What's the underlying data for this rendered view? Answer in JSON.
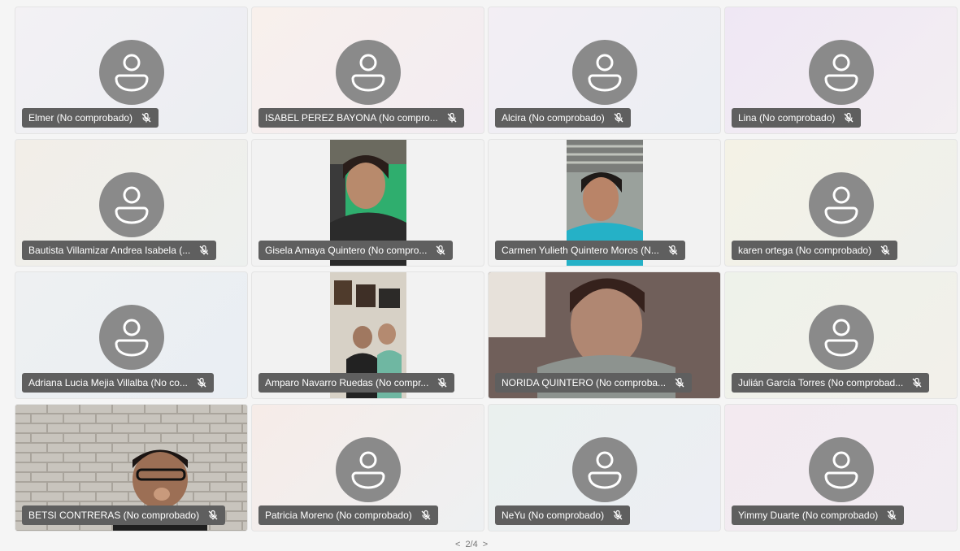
{
  "participants": [
    {
      "name": "Elmer (No comprobado)",
      "bg": "linear-gradient(135deg,#f3f1f4,#ebedf2)",
      "video": false
    },
    {
      "name": "ISABEL PEREZ BAYONA (No compro...",
      "bg": "linear-gradient(135deg,#f8f0ec,#f2ecf2)",
      "video": false
    },
    {
      "name": "Alcira (No comprobado)",
      "bg": "linear-gradient(135deg,#f3eef4,#ebeef3)",
      "video": false
    },
    {
      "name": "Lina (No comprobado)",
      "bg": "linear-gradient(135deg,#efe7f4,#f3eef2)",
      "video": false
    },
    {
      "name": "Bautista Villamizar Andrea Isabela (...",
      "bg": "linear-gradient(135deg,#f2eee8,#edf0ee)",
      "video": false
    },
    {
      "name": "Gisela Amaya Quintero (No compro...",
      "bg": "#f2f2f2",
      "video": "narrow-green"
    },
    {
      "name": "Carmen Yulieth Quintero Moros (N...",
      "bg": "#f2f2f2",
      "video": "narrow-blue"
    },
    {
      "name": "karen ortega (No comprobado)",
      "bg": "linear-gradient(135deg,#f4f2e6,#eef0ec)",
      "video": false
    },
    {
      "name": "Adriana Lucia Mejia Villalba (No co...",
      "bg": "linear-gradient(135deg,#eef0f2,#e9eef3)",
      "video": false
    },
    {
      "name": "Amparo Navarro Ruedas (No compr...",
      "bg": "#f2f2f2",
      "video": "narrow-room"
    },
    {
      "name": "NORIDA QUINTERO (No comproba...",
      "bg": "#6f625d",
      "video": "full"
    },
    {
      "name": "Julián García Torres (No comprobad...",
      "bg": "linear-gradient(135deg,#eef2ea,#f2f0ea)",
      "video": false
    },
    {
      "name": "BETSI CONTRERAS (No comprobado)",
      "bg": "#b9b4ae",
      "video": "brick"
    },
    {
      "name": "Patricia Moreno (No comprobado)",
      "bg": "linear-gradient(135deg,#f6ece8,#eef0f2)",
      "video": false
    },
    {
      "name": "NeYu (No comprobado)",
      "bg": "linear-gradient(135deg,#eaf0ee,#eceef4)",
      "video": false
    },
    {
      "name": "Yimmy Duarte (No comprobado)",
      "bg": "linear-gradient(135deg,#f3eaf0,#f1ecf2)",
      "video": false
    }
  ],
  "pager": {
    "prev": "<",
    "page": "2/4",
    "next": ">"
  }
}
